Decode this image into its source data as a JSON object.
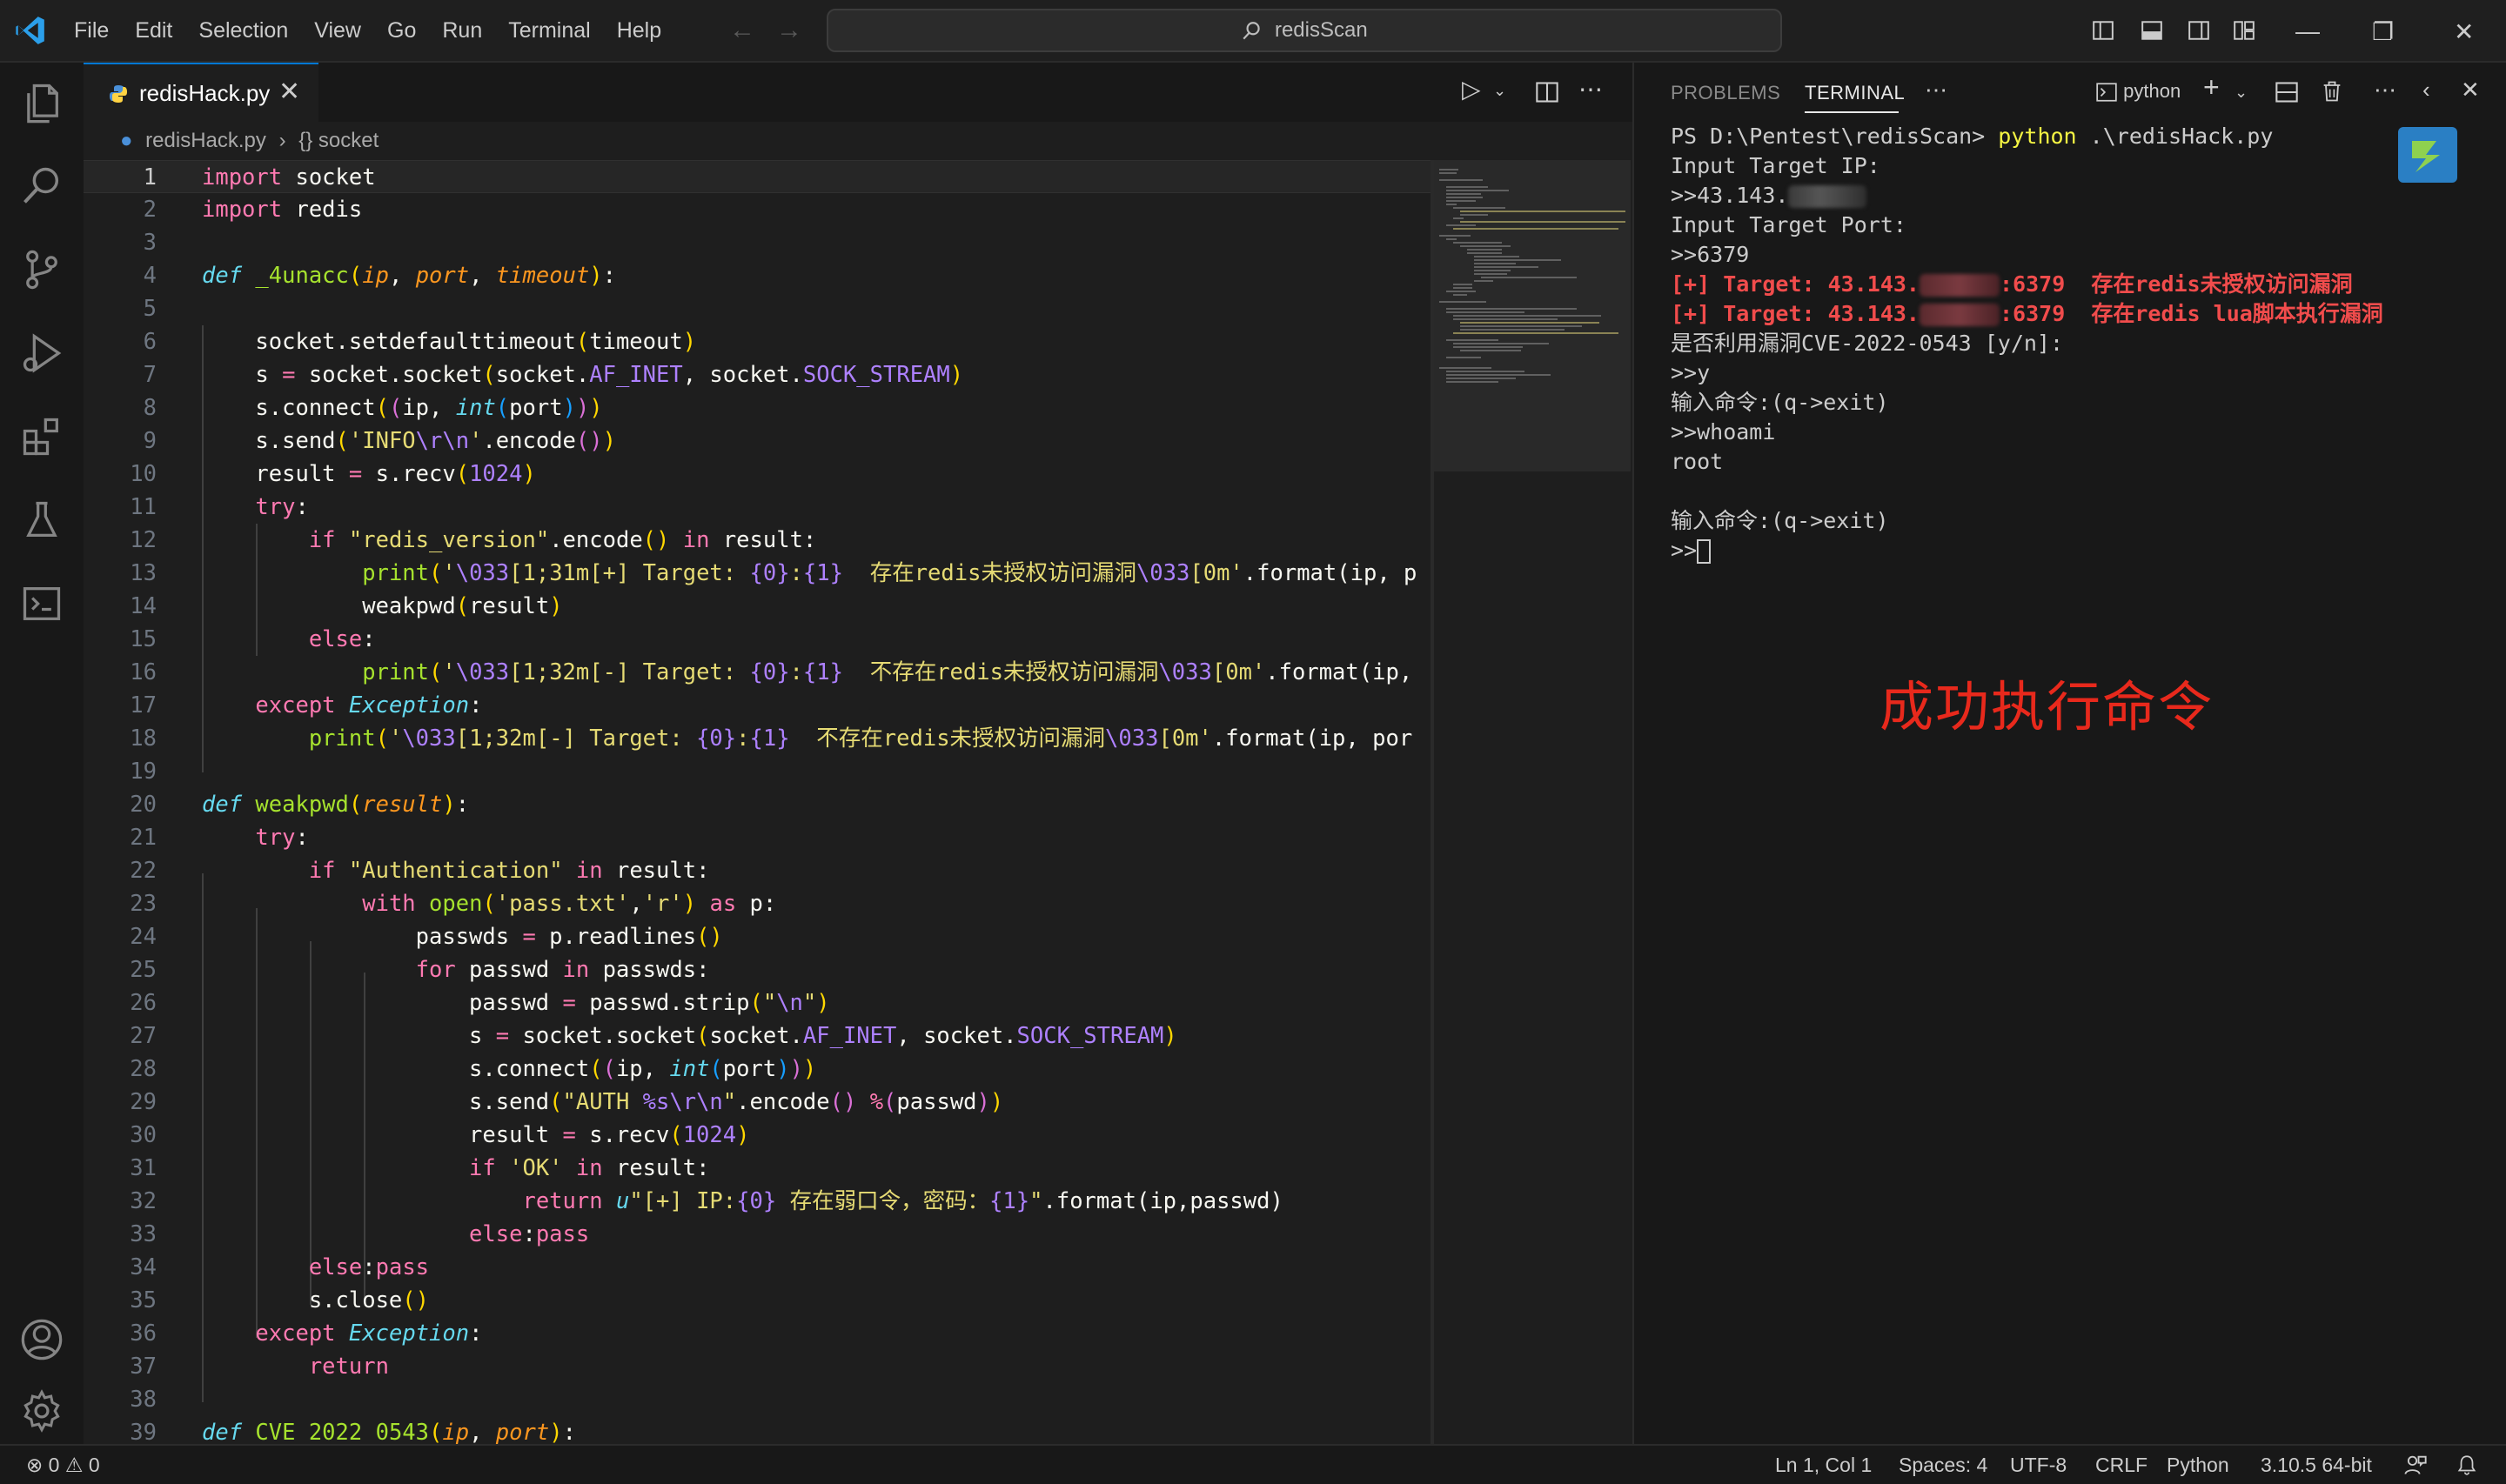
{
  "menu": [
    "File",
    "Edit",
    "Selection",
    "View",
    "Go",
    "Run",
    "Terminal",
    "Help"
  ],
  "command_center": "redisScan",
  "icons": {
    "app": "vscode-icon",
    "activity": [
      "explorer-icon",
      "search-icon",
      "source-control-icon",
      "run-debug-icon",
      "extensions-icon",
      "testing-icon",
      "remote-explorer-icon",
      "accounts-icon",
      "manage-gear-icon"
    ],
    "layout": [
      "toggle-primary-sidebar-icon",
      "toggle-panel-icon",
      "toggle-secondary-sidebar-icon",
      "customize-layout-icon"
    ]
  },
  "editor": {
    "tab_label": "redisHack.py",
    "tab_close": "✕",
    "breadcrumb_file": "redisHack.py",
    "breadcrumb_symbol": "{} socket",
    "active_line": 1,
    "lines": [
      "1",
      "2",
      "3",
      "4",
      "5",
      "6",
      "7",
      "8",
      "9",
      "10",
      "11",
      "12",
      "13",
      "14",
      "15",
      "16",
      "17",
      "18",
      "19",
      "20",
      "21",
      "22",
      "23",
      "24",
      "25",
      "26",
      "27",
      "28",
      "29",
      "30",
      "31",
      "32",
      "33",
      "34",
      "35",
      "36",
      "37",
      "38",
      "39"
    ]
  },
  "code_text": {
    "l13_msg": "存在redis未授权访问漏洞",
    "l16_msg": "不存在redis未授权访问漏洞",
    "l18_msg": "不存在redis未授权访问漏洞",
    "l32_msg": "存在弱口令，密码："
  },
  "panel": {
    "tab_problems": "PROBLEMS",
    "tab_terminal": "TERMINAL",
    "terminal_name": "python",
    "terminal": {
      "prompt": "PS D:\\Pentest\\redisScan>",
      "cmd": "python",
      "cmd_arg": " .\\redisHack.py",
      "l2": "Input Target IP:",
      "l3": ">>43.143.",
      "l4": "Input Target Port:",
      "l5": ">>6379",
      "l6a": "[+] Target: 43.143.",
      "l6b": ":6379  存在redis未授权访问漏洞",
      "l7a": "[+] Target: 43.143.",
      "l7b": ":6379  存在redis lua脚本执行漏洞",
      "l8": "是否利用漏洞CVE-2022-0543 [y/n]:",
      "l9": ">>y",
      "l10": "输入命令:(q->exit)",
      "l11": ">>whoami",
      "l12": "root",
      "l13": "",
      "l14": "输入命令:(q->exit)",
      "l15": ">>"
    },
    "annotation": "成功执行命令"
  },
  "status": {
    "errors": "0",
    "warnings": "0",
    "position": "Ln 1, Col 1",
    "spaces": "Spaces: 4",
    "encoding": "UTF-8",
    "eol": "CRLF",
    "language": "Python",
    "interpreter": "3.10.5 64-bit"
  },
  "colors": {
    "accent": "#0078d4",
    "terminal_red": "#f14c4c",
    "annotation_red": "#e8291c"
  }
}
